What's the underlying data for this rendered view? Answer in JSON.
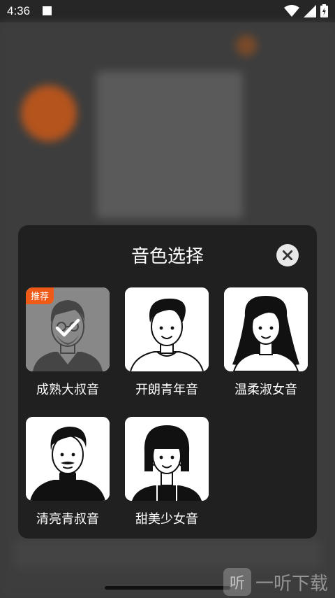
{
  "status_bar": {
    "time": "4:36"
  },
  "dialog": {
    "title": "音色选择",
    "close_icon": "close-icon",
    "voices": [
      {
        "label": "成熟大叔音",
        "selected": true,
        "badge": "推荐",
        "avatar": "man-glasses-beard"
      },
      {
        "label": "开朗青年音",
        "selected": false,
        "avatar": "young-man"
      },
      {
        "label": "温柔淑女音",
        "selected": false,
        "avatar": "woman-long-hair"
      },
      {
        "label": "清亮青叔音",
        "selected": false,
        "avatar": "man-mustache-turtleneck"
      },
      {
        "label": "甜美少女音",
        "selected": false,
        "avatar": "girl-bob-hair"
      }
    ]
  },
  "watermark": {
    "text": "一听下载",
    "icon": "听"
  },
  "colors": {
    "badge": "#f05a18",
    "dialog_bg": "#202020"
  }
}
